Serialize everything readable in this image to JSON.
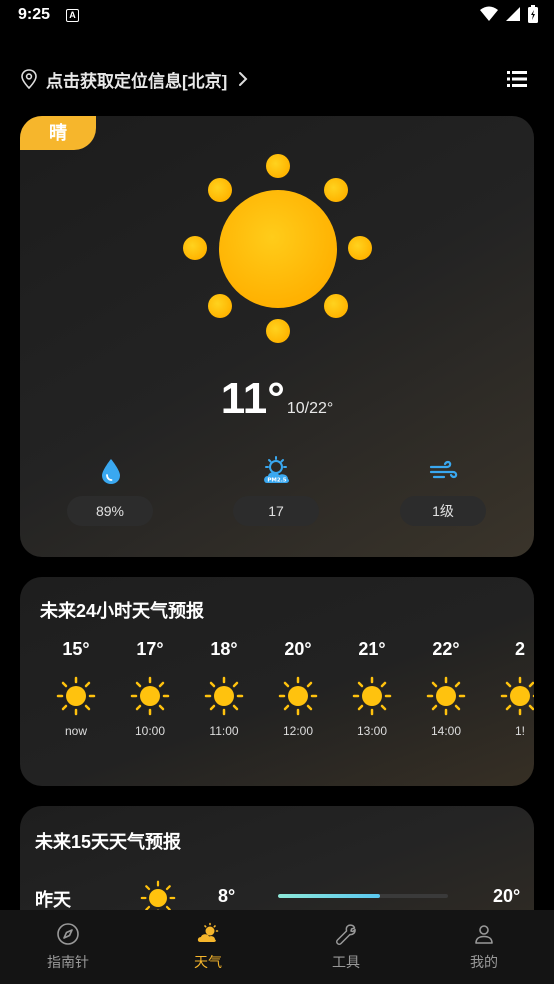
{
  "status_bar": {
    "time": "9:25",
    "notif_letter": "A"
  },
  "location": {
    "text": "点击获取定位信息[北京]"
  },
  "current": {
    "condition": "晴",
    "temp": "11°",
    "range": "10/22°",
    "humidity": "89%",
    "pm25": "17",
    "pm25_icon_text": "PM2.5",
    "wind": "1级"
  },
  "hourly": {
    "title": "未来24小时天气预报",
    "items": [
      {
        "temp": "15°",
        "time": "now"
      },
      {
        "temp": "17°",
        "time": "10:00"
      },
      {
        "temp": "18°",
        "time": "11:00"
      },
      {
        "temp": "20°",
        "time": "12:00"
      },
      {
        "temp": "21°",
        "time": "13:00"
      },
      {
        "temp": "22°",
        "time": "14:00"
      },
      {
        "temp": "2",
        "time": "1!"
      }
    ]
  },
  "daily": {
    "title": "未来15天天气预报",
    "rows": [
      {
        "day": "昨天",
        "low": "8°",
        "high": "20°",
        "bar_start": 0.0,
        "bar_end": 0.6
      }
    ]
  },
  "nav": {
    "items": [
      {
        "label": "指南针",
        "icon": "compass-icon"
      },
      {
        "label": "天气",
        "icon": "weather-icon"
      },
      {
        "label": "工具",
        "icon": "wrench-icon"
      },
      {
        "label": "我的",
        "icon": "profile-icon"
      }
    ],
    "active": "天气"
  },
  "colors": {
    "accent": "#f6b62c",
    "sun": "#ffc20e",
    "blue_icon": "#3aa8f0",
    "bar_fill": "#5ac8f0"
  }
}
